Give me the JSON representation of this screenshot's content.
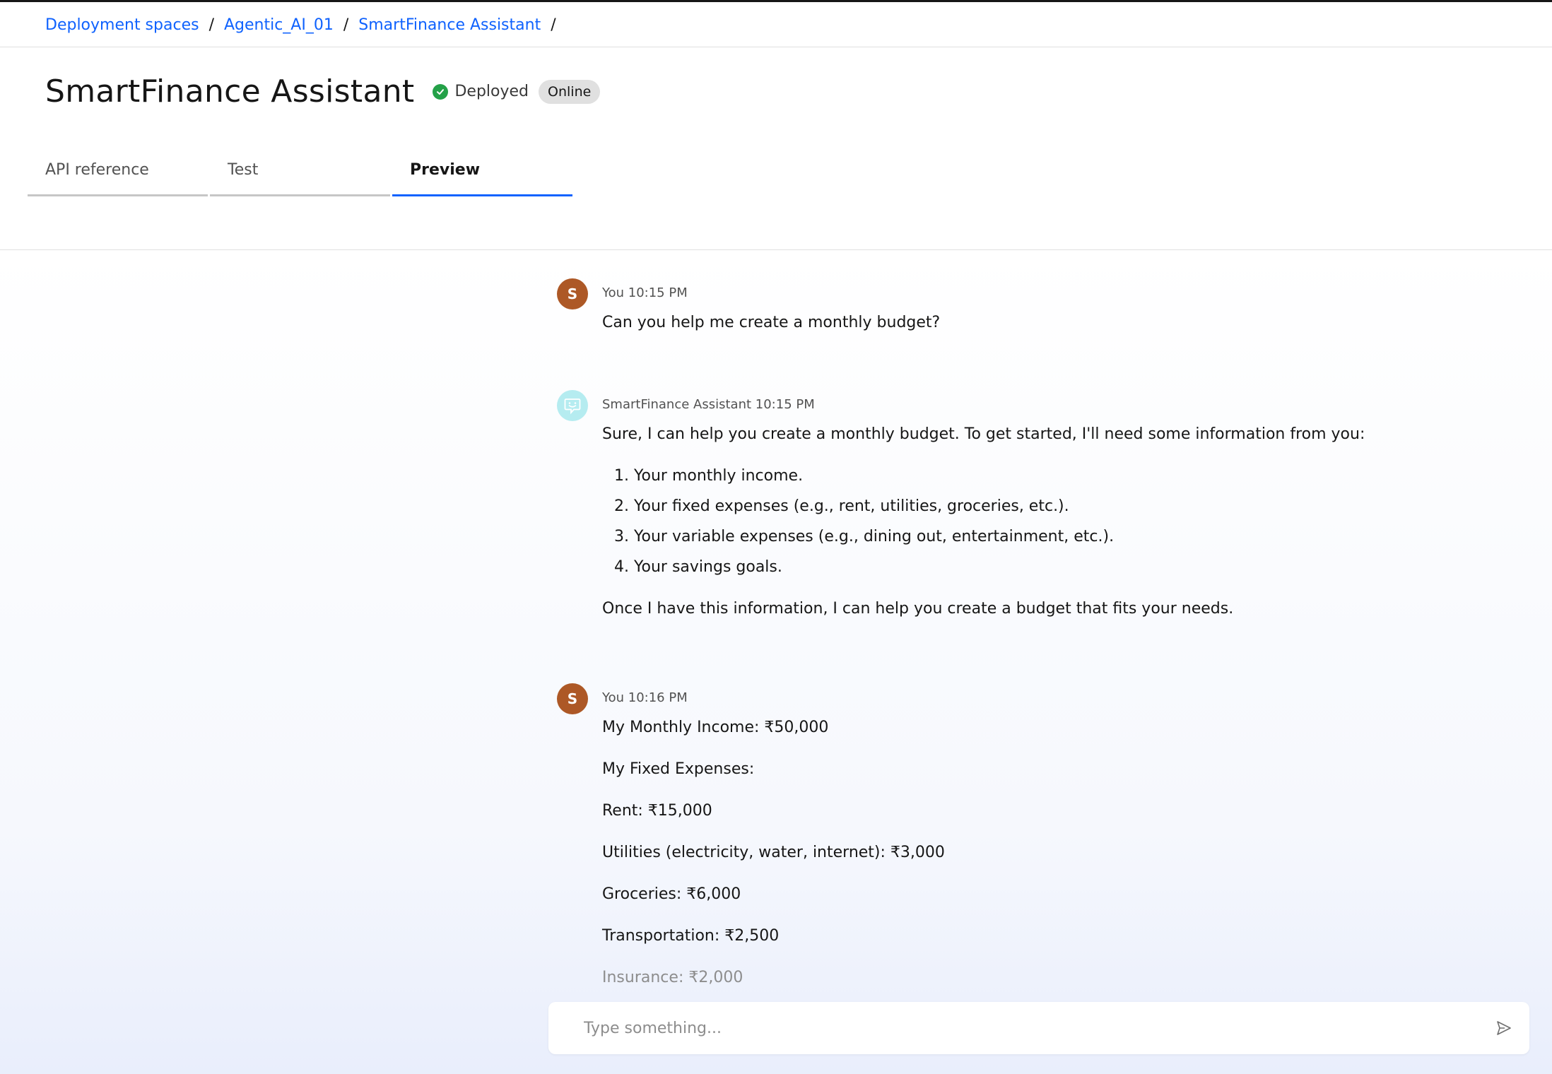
{
  "breadcrumb": [
    {
      "label": "Deployment spaces"
    },
    {
      "label": "Agentic_AI_01"
    },
    {
      "label": "SmartFinance Assistant"
    }
  ],
  "breadcrumb_separator": "/",
  "header": {
    "title": "SmartFinance Assistant",
    "status": "Deployed",
    "badge": "Online"
  },
  "tabs": [
    {
      "label": "API reference",
      "active": false
    },
    {
      "label": "Test",
      "active": false
    },
    {
      "label": "Preview",
      "active": true
    }
  ],
  "messages": [
    {
      "sender": "You",
      "time": "10:15 PM",
      "avatar_letter": "S",
      "lines": [
        "Can you help me create a monthly budget?"
      ]
    },
    {
      "sender": "SmartFinance Assistant",
      "time": "10:15 PM",
      "intro": "Sure, I can help you create a monthly budget. To get started, I'll need some information from you:",
      "list": [
        "Your monthly income.",
        "Your fixed expenses (e.g., rent, utilities, groceries, etc.).",
        "Your variable expenses (e.g., dining out, entertainment, etc.).",
        "Your savings goals."
      ],
      "outro": "Once I have this information, I can help you create a budget that fits your needs."
    },
    {
      "sender": "You",
      "time": "10:16 PM",
      "avatar_letter": "S",
      "lines": [
        "My Monthly Income: ₹50,000",
        "My Fixed Expenses:",
        "Rent: ₹15,000",
        "Utilities (electricity, water, internet): ₹3,000",
        "Groceries: ₹6,000",
        "Transportation: ₹2,500",
        "Insurance: ₹2,000"
      ]
    }
  ],
  "composer": {
    "placeholder": "Type something..."
  },
  "icons": {
    "status": "checkmark-filled-icon",
    "bot_avatar": "chat-bot-icon",
    "send": "send-icon"
  },
  "colors": {
    "link": "#0f62fe",
    "active_tab": "#0f62fe",
    "status_green": "#24a148",
    "user_avatar": "#ad5826",
    "bot_avatar": "#b5ecf0"
  }
}
